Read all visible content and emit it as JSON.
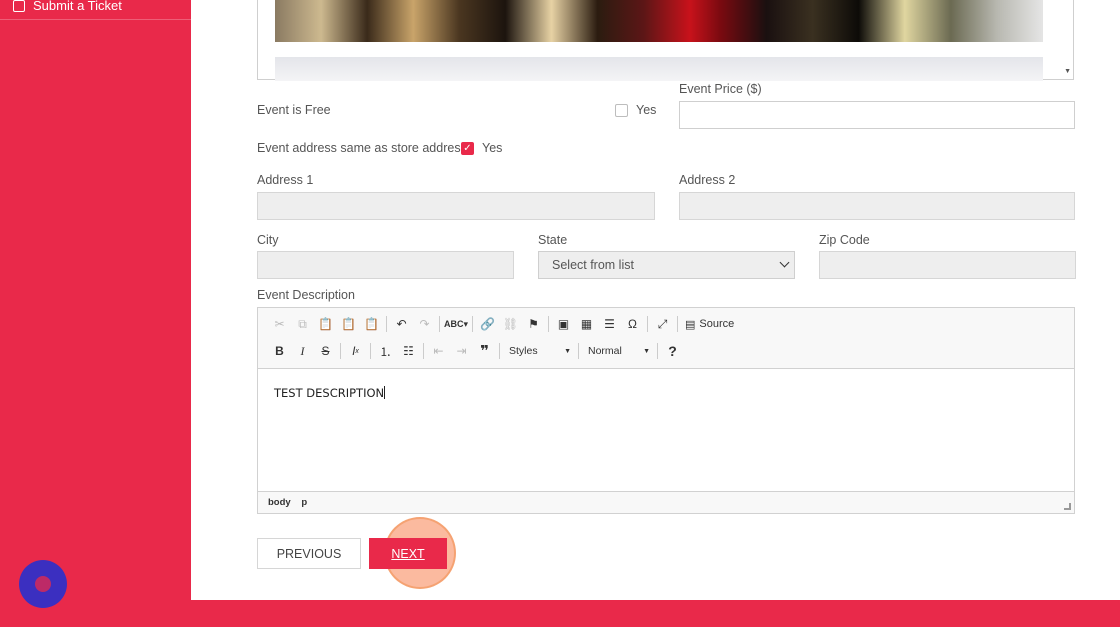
{
  "sidebar": {
    "items": [
      {
        "label": "Submit a Ticket",
        "icon": "ticket-icon"
      }
    ]
  },
  "form": {
    "event_is_free": {
      "label": "Event is Free",
      "checkbox_label": "Yes",
      "checked": false
    },
    "event_price": {
      "label": "Event Price ($)",
      "value": ""
    },
    "same_address": {
      "label": "Event address same as store address",
      "checkbox_label": "Yes",
      "checked": true
    },
    "address1": {
      "label": "Address 1",
      "value": ""
    },
    "address2": {
      "label": "Address 2",
      "value": ""
    },
    "city": {
      "label": "City",
      "value": ""
    },
    "state": {
      "label": "State",
      "selected": "Select from list"
    },
    "zip": {
      "label": "Zip Code",
      "value": ""
    },
    "description": {
      "label": "Event Description",
      "content": "TEST DESCRIPTION"
    }
  },
  "editor": {
    "source_label": "Source",
    "styles_label": "Styles",
    "format_label": "Normal",
    "status_path": [
      "body",
      "p"
    ]
  },
  "buttons": {
    "previous": "PREVIOUS",
    "next": "NEXT"
  },
  "colors": {
    "accent": "#e9294a",
    "chat": "#3b2fc0",
    "highlight": "#f78250"
  }
}
